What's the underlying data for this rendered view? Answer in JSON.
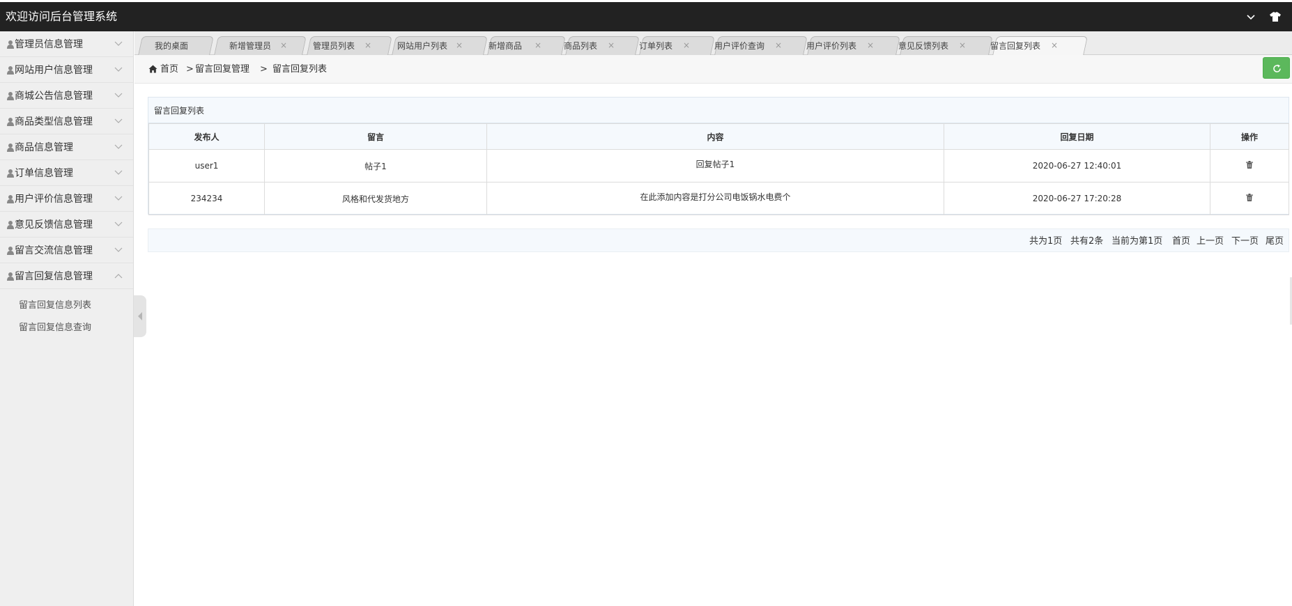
{
  "app": {
    "title": "欢迎访问后台管理系统"
  },
  "sidebar": {
    "items": [
      {
        "label": "管理员信息管理"
      },
      {
        "label": "网站用户信息管理"
      },
      {
        "label": "商城公告信息管理"
      },
      {
        "label": "商品类型信息管理"
      },
      {
        "label": "商品信息管理"
      },
      {
        "label": "订单信息管理"
      },
      {
        "label": "用户评价信息管理"
      },
      {
        "label": "意见反馈信息管理"
      },
      {
        "label": "留言交流信息管理"
      },
      {
        "label": "留言回复信息管理"
      }
    ],
    "submenu": [
      {
        "label": "留言回复信息列表"
      },
      {
        "label": "留言回复信息查询"
      }
    ]
  },
  "tabs": [
    {
      "label": "我的桌面"
    },
    {
      "label": "新增管理员"
    },
    {
      "label": "管理员列表"
    },
    {
      "label": "网站用户列表"
    },
    {
      "label": "新增商品"
    },
    {
      "label": "商品列表"
    },
    {
      "label": "订单列表"
    },
    {
      "label": "用户评价查询"
    },
    {
      "label": "用户评价列表"
    },
    {
      "label": "意见反馈列表"
    },
    {
      "label": "留言回复列表"
    }
  ],
  "tab_close_glyph": "×",
  "breadcrumb": {
    "home": "首页",
    "sep": ">",
    "level1": "留言回复管理",
    "level2": "留言回复列表"
  },
  "panel": {
    "title": "留言回复列表"
  },
  "table": {
    "headers": [
      "发布人",
      "留言",
      "内容",
      "回复日期",
      "操作"
    ],
    "rows": [
      {
        "author": "user1",
        "message": "帖子1",
        "content": "回复帖子1",
        "date": "2020-06-27 12:40:01"
      },
      {
        "author": "234234",
        "message": "风格和代发货地方",
        "content": "在此添加内容是打分公司电饭锅水电费个",
        "date": "2020-06-27 17:20:28"
      }
    ]
  },
  "pager": {
    "total_pages": "共为1页",
    "total_items": "共有2条",
    "current": "当前为第1页",
    "first": "首页",
    "prev": "上一页",
    "next": "下一页",
    "last": "尾页"
  },
  "colors": {
    "topbar": "#222222",
    "refresh": "#5cb85c",
    "panel_head": "#f5f9fd"
  },
  "icons": [
    "chevron-down-icon",
    "tshirt-icon",
    "user-icon",
    "home-icon",
    "refresh-icon",
    "trash-icon",
    "collapse-arrow-icon"
  ]
}
